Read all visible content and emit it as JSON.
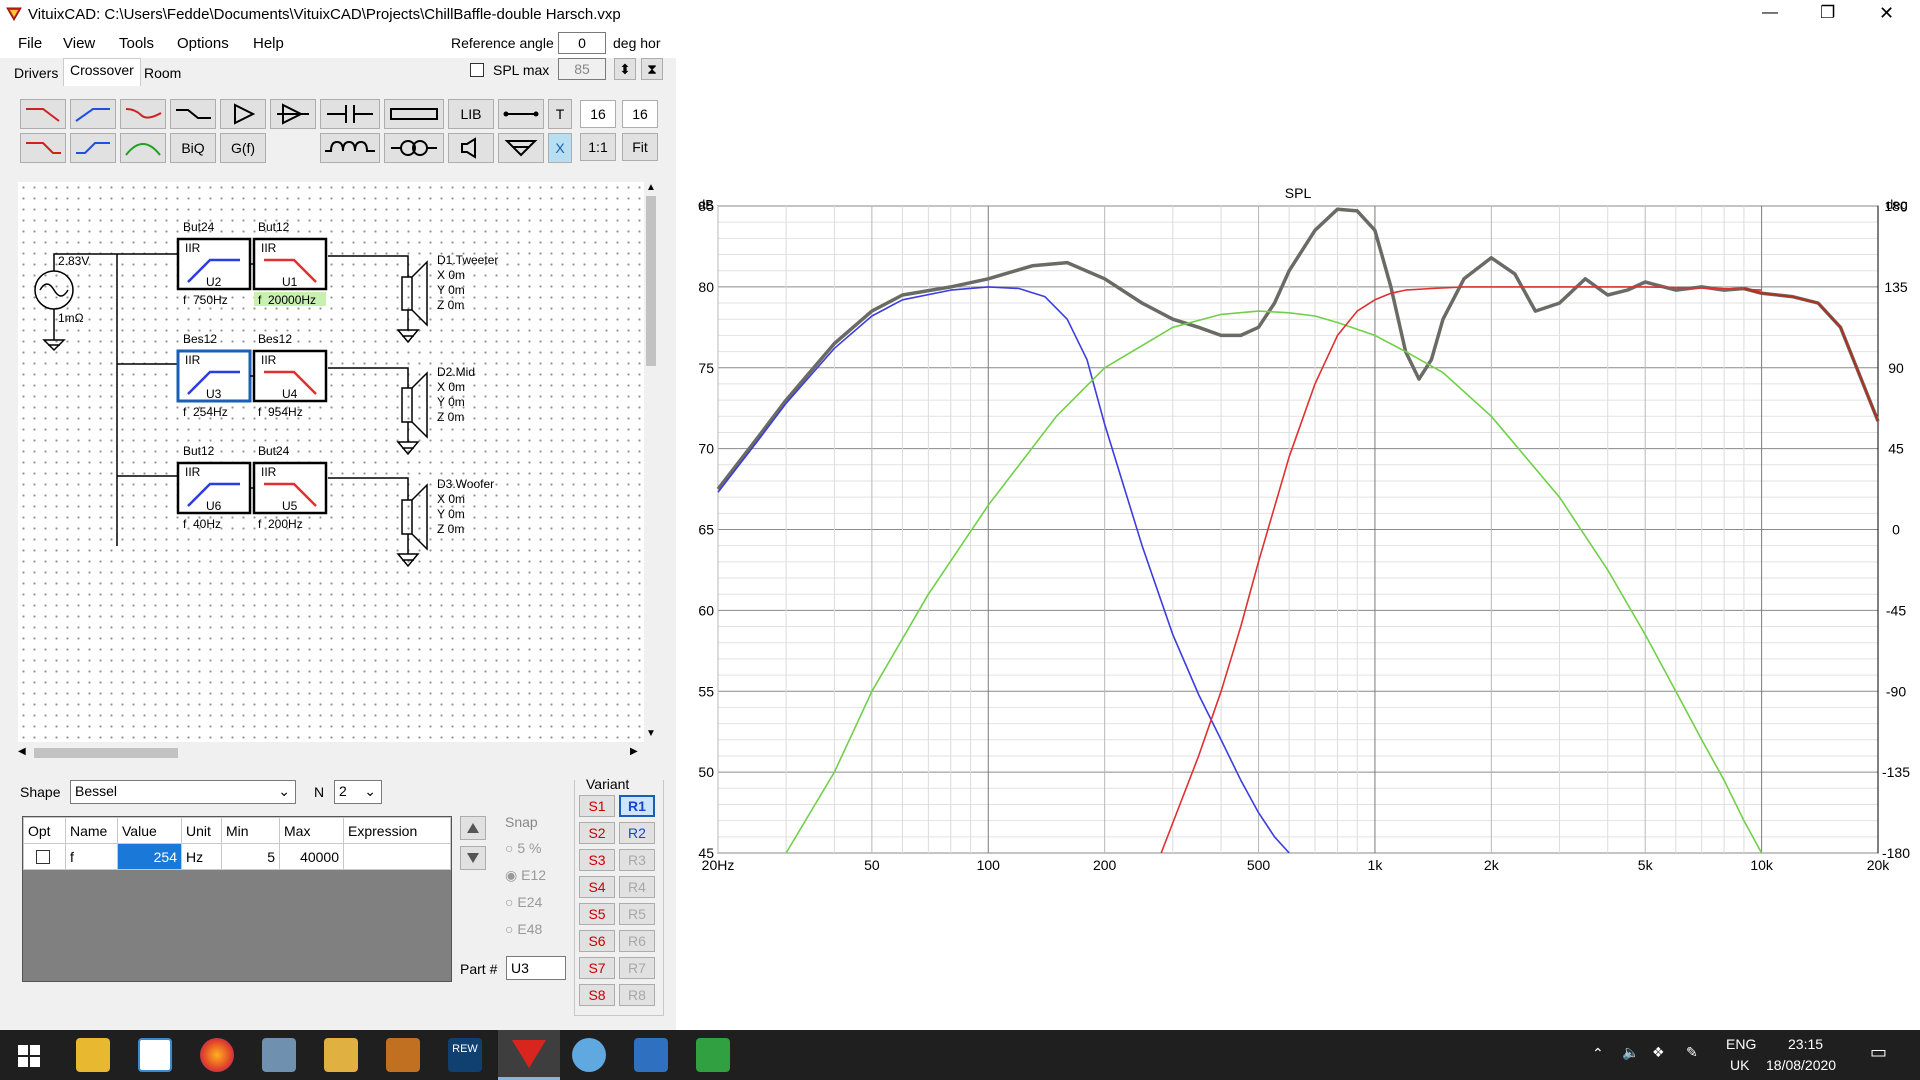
{
  "window": {
    "title": "VituixCAD: C:\\Users\\Fedde\\Documents\\VituixCAD\\Projects\\ChillBaffle-double Harsch.vxp",
    "minimize": "—",
    "maximize": "❐",
    "close": "✕"
  },
  "menu": {
    "file": "File",
    "view": "View",
    "tools": "Tools",
    "options": "Options",
    "help": "Help"
  },
  "topcontrols": {
    "ref_angle_label": "Reference angle",
    "ref_angle_value": "0",
    "deg_hor": "deg hor",
    "spl_max_label": "SPL max",
    "spl_max_value": "85"
  },
  "tabs": {
    "drivers": "Drivers",
    "crossover": "Crossover",
    "room": "Room"
  },
  "toolbar": {
    "lib": "LIB",
    "t": "T",
    "grid1": "16",
    "grid2": "16",
    "biq": "BiQ",
    "gf": "G(f)",
    "x": "X",
    "one": "1:1",
    "fit": "Fit"
  },
  "schematic": {
    "source_v": "2.83V",
    "source_r": "1mΩ",
    "zero": "0",
    "u2": {
      "type": "But24",
      "iir": "IIR",
      "name": "U2",
      "f": "f  750Hz"
    },
    "u1": {
      "type": "But12",
      "iir": "IIR",
      "name": "U1",
      "f": "f  20000Hz"
    },
    "u3": {
      "type": "Bes12",
      "iir": "IIR",
      "name": "U3",
      "f": "f  254Hz"
    },
    "u4": {
      "type": "Bes12",
      "iir": "IIR",
      "name": "U4",
      "f": "f  954Hz"
    },
    "u6": {
      "type": "But12",
      "iir": "IIR",
      "name": "U6",
      "f": "f  40Hz"
    },
    "u5": {
      "type": "But24",
      "iir": "IIR",
      "name": "U5",
      "f": "f  200Hz"
    },
    "d1": {
      "name": "D1.Tweeter",
      "x": "X 0m",
      "y": "Y 0m",
      "z": "Z 0m"
    },
    "d2": {
      "name": "D2.Mid",
      "x": "X 0m",
      "y": "Y 0m",
      "z": "Z 0m"
    },
    "d3": {
      "name": "D3.Woofer",
      "x": "X 0m",
      "y": "Y 0m",
      "z": "Z 0m"
    }
  },
  "props": {
    "shape_label": "Shape",
    "shape_value": "Bessel",
    "n_label": "N",
    "n_value": "2",
    "headers": [
      "Opt",
      "Name",
      "Value",
      "Unit",
      "Min",
      "Max",
      "Expression"
    ],
    "row": {
      "name": "f",
      "value": "254",
      "unit": "Hz",
      "min": "5",
      "max": "40000",
      "expression": ""
    },
    "snap_label": "Snap",
    "snap": [
      "5 %",
      "E12",
      "E24",
      "E48"
    ],
    "part_label": "Part #",
    "part_value": "U3",
    "variant_label": "Variant",
    "variants_s": [
      "S1",
      "S2",
      "S3",
      "S4",
      "S5",
      "S6",
      "S7",
      "S8"
    ],
    "variants_r": [
      "R1",
      "R2",
      "R3",
      "R4",
      "R5",
      "R6",
      "R7",
      "R8"
    ]
  },
  "taskbar": {
    "lang1": "ENG",
    "lang2": "UK",
    "time": "23:15",
    "date": "18/08/2020",
    "rew": "REW"
  },
  "colors": {
    "sum": "#6b6b65",
    "tweeter": "#e03030",
    "mid": "#70d048",
    "woofer": "#3c3ce0",
    "tail": "#b03020"
  },
  "chart_data": {
    "type": "line",
    "title": "SPL",
    "xlabel": "",
    "ylabel": "dB",
    "y2label": "deg",
    "xscale": "log",
    "xlim": [
      20,
      20000
    ],
    "ylim": [
      45,
      85
    ],
    "y2lim": [
      -180,
      180
    ],
    "xticks": [
      "20Hz",
      "50",
      "100",
      "200",
      "500",
      "1k",
      "2k",
      "5k",
      "10k",
      "20k"
    ],
    "xtick_values": [
      20,
      50,
      100,
      200,
      500,
      1000,
      2000,
      5000,
      10000,
      20000
    ],
    "yticks": [
      45,
      50,
      55,
      60,
      65,
      70,
      75,
      80,
      85
    ],
    "y2ticks": [
      "180",
      "135",
      "90",
      "45",
      "0",
      "-45",
      "-90",
      "-135",
      "-180"
    ],
    "series": [
      {
        "color": "#6b6b65",
        "x": [
          20,
          25,
          30,
          40,
          50,
          60,
          80,
          100,
          130,
          160,
          200,
          250,
          300,
          350,
          400,
          450,
          500,
          550,
          600,
          700,
          800,
          900,
          1000,
          1100,
          1200,
          1300,
          1400,
          1500,
          1700,
          2000,
          2300,
          2600,
          3000,
          3500,
          4000,
          4500,
          5000,
          6000,
          7000,
          8000,
          9000,
          10000,
          12000,
          14000,
          16000,
          20000
        ],
        "y": [
          67.5,
          70.5,
          73,
          76.5,
          78.5,
          79.5,
          80,
          80.5,
          81.3,
          81.5,
          80.5,
          79,
          78,
          77.5,
          77,
          77,
          77.5,
          79,
          81,
          83.5,
          84.8,
          84.7,
          83.5,
          80,
          76,
          74.3,
          75.5,
          78,
          80.5,
          81.8,
          80.8,
          78.5,
          79,
          80.5,
          79.5,
          79.8,
          80.3,
          79.8,
          80,
          79.8,
          79.9,
          79.6,
          79.4,
          79,
          77.5,
          71.7
        ]
      },
      {
        "color": "#3c3ce0",
        "x": [
          20,
          25,
          30,
          40,
          50,
          60,
          80,
          100,
          120,
          140,
          160,
          180,
          200,
          250,
          300,
          350,
          400,
          450,
          500,
          550,
          600
        ],
        "y": [
          67.3,
          70.3,
          72.8,
          76.2,
          78.2,
          79.2,
          79.8,
          80,
          79.9,
          79.4,
          78,
          75.5,
          71.5,
          64,
          58.5,
          54.8,
          52,
          49.5,
          47.5,
          46,
          45
        ]
      },
      {
        "color": "#70d048",
        "x": [
          30,
          40,
          50,
          70,
          100,
          150,
          200,
          300,
          400,
          500,
          600,
          700,
          800,
          1000,
          1200,
          1500,
          2000,
          3000,
          4000,
          5000,
          6000,
          7000,
          8000,
          9000,
          10000
        ],
        "y": [
          45,
          50,
          55,
          61,
          66.5,
          72,
          75,
          77.5,
          78.3,
          78.5,
          78.4,
          78.2,
          77.8,
          77,
          76,
          74.7,
          72,
          67,
          62.5,
          58.5,
          55,
          52,
          49.5,
          47,
          45
        ]
      },
      {
        "color": "#e03030",
        "x": [
          280,
          350,
          400,
          450,
          500,
          600,
          700,
          800,
          900,
          1000,
          1100,
          1200,
          1400,
          1700,
          2000,
          3000,
          5000,
          8000,
          10000
        ],
        "y": [
          45,
          51,
          55,
          59,
          63,
          69.5,
          74,
          77,
          78.5,
          79.2,
          79.6,
          79.8,
          79.9,
          80,
          80,
          80,
          80,
          79.9,
          79.8
        ]
      }
    ]
  }
}
